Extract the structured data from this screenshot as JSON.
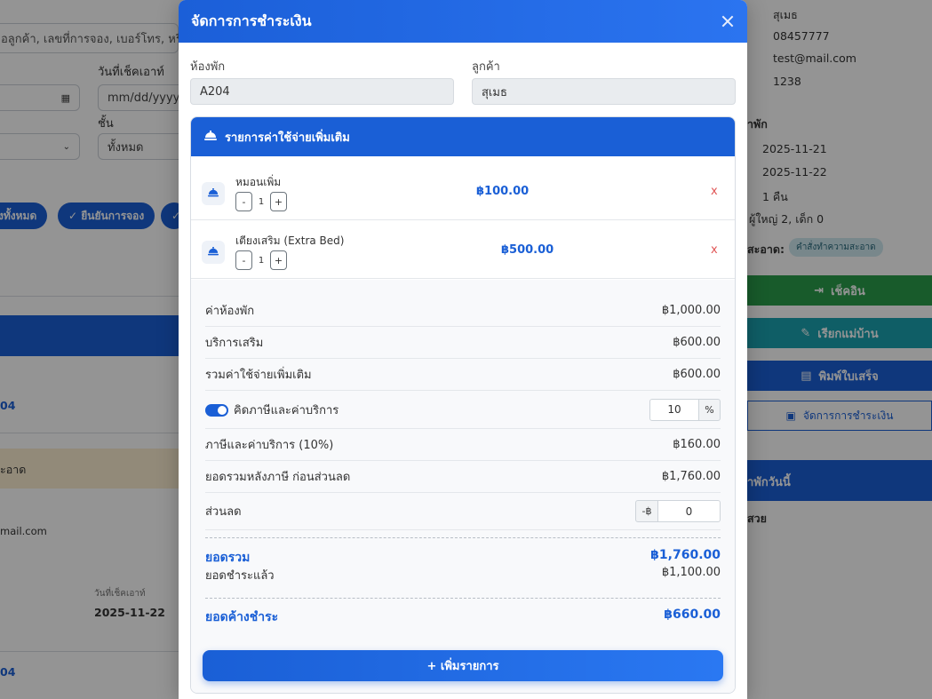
{
  "background": {
    "search_placeholder": "อลูกค้า, เลขที่การจอง, เบอร์โทร, หรือเลข",
    "checkout_label": "วันที่เช็คเอาท์",
    "date_placeholder": "mm/dd/yyyy",
    "floor_label": "ชั้น",
    "floor_value": "ทั้งหมด",
    "chip_all": "งทั้งหมด",
    "chip_confirm": "✓ ยืนยันการจอง",
    "chip_more": "✓",
    "room_code_1": "04",
    "clean_text": "ะอาด",
    "email_partial": "mail.com",
    "checkout_small_label": "วันที่เช็คเอาท์",
    "checkout_date": "2025-11-22",
    "room_code_2": "04",
    "right": {
      "customer_name": "สุเมธ",
      "phone": "08457777",
      "email": "test@mail.com",
      "code": "1238",
      "stay_header": "าพัก",
      "checkin": "2025-11-21",
      "checkout": "2025-11-22",
      "nights": "1 คืน",
      "guests": "ผู้ใหญ่ 2, เด็ก 0",
      "clean_label": "สะอาด:",
      "clean_badge": "คำสั่งทำความสะอาด",
      "btn_checkin": "เช็คอิน",
      "btn_housekeeper": "เรียกแม่บ้าน",
      "btn_print": "พิมพ์ใบเสร็จ",
      "btn_payment": "จัดการการชำระเงิน",
      "today_header": "าพักวันนี้",
      "today_text": "สวย"
    }
  },
  "modal": {
    "title": "จัดการการชำระเงิน",
    "room_label": "ห้องพัก",
    "room_value": "A204",
    "customer_label": "ลูกค้า",
    "customer_value": "สุเมธ",
    "extras_header": "รายการค่าใช้จ่ายเพิ่มเติม",
    "items": [
      {
        "name": "หมอนเพิ่ม",
        "qty": "1",
        "price": "฿100.00",
        "remove": "x",
        "minus": "-",
        "plus": "+"
      },
      {
        "name": "เตียงเสริม (Extra Bed)",
        "qty": "1",
        "price": "฿500.00",
        "remove": "x",
        "minus": "-",
        "plus": "+"
      }
    ],
    "summary": {
      "room_charge_label": "ค่าห้องพัก",
      "room_charge": "฿1,000.00",
      "services_label": "บริการเสริม",
      "services": "฿600.00",
      "extras_total_label": "รวมค่าใช้จ่ายเพิ่มเติม",
      "extras_total": "฿600.00",
      "tax_toggle_label": "คิดภาษีและค่าบริการ",
      "tax_rate": "10",
      "tax_unit": "%",
      "tax_label": "ภาษีและค่าบริการ (10%)",
      "tax_amount": "฿160.00",
      "after_tax_label": "ยอดรวมหลังภาษี ก่อนส่วนลด",
      "after_tax": "฿1,760.00",
      "discount_label": "ส่วนลด",
      "discount_unit": "-฿",
      "discount_value": "0",
      "grand_total_label": "ยอดรวม",
      "grand_total": "฿1,760.00",
      "paid_label": "ยอดชำระแล้ว",
      "paid": "฿1,100.00",
      "outstanding_label": "ยอดค้างชำระ",
      "outstanding": "฿660.00"
    },
    "add_button": "+ เพิ่มรายการ"
  }
}
